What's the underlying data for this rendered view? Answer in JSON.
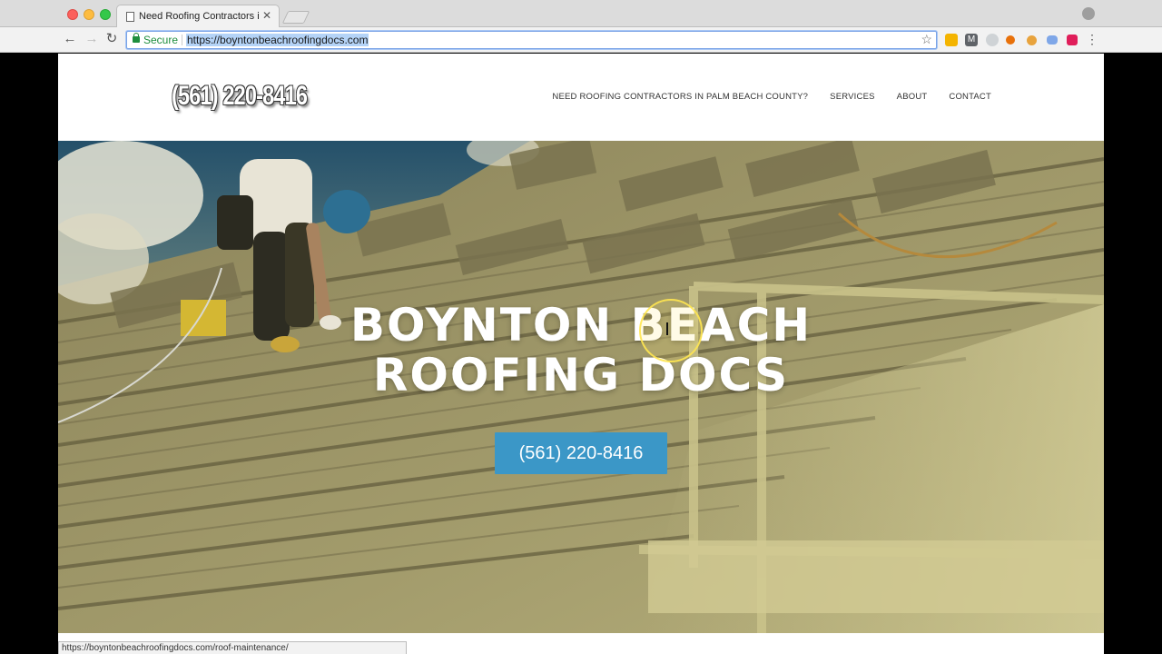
{
  "browser": {
    "tab_title": "Need Roofing Contractors in P",
    "tab_close": "✕",
    "secure_label": "Secure",
    "url": "https://boyntonbeachroofingdocs.com",
    "status_url": "https://boyntonbeachroofingdocs.com/roof-maintenance/",
    "extensions": [
      {
        "name": "bell-extension-icon",
        "color": "#f4b400"
      },
      {
        "name": "gmail-extension-icon",
        "color": "#5f6368"
      },
      {
        "name": "k-extension-icon",
        "color": "#9aa0a6"
      },
      {
        "name": "wand-extension-icon",
        "color": "#e8710a"
      },
      {
        "name": "cookie-extension-icon",
        "color": "#e8a33d"
      },
      {
        "name": "link-extension-icon",
        "color": "#4285f4"
      },
      {
        "name": "slack-extension-icon",
        "color": "#e01e5a"
      }
    ]
  },
  "site": {
    "logo_phone": "(561) 220-8416",
    "nav": [
      "NEED ROOFING CONTRACTORS IN PALM BEACH COUNTY?",
      "SERVICES",
      "ABOUT",
      "CONTACT"
    ],
    "hero": {
      "title_line1": "BOYNTON BEACH",
      "title_line2": "ROOFING DOCS",
      "cta_label": "(561) 220-8416"
    }
  }
}
